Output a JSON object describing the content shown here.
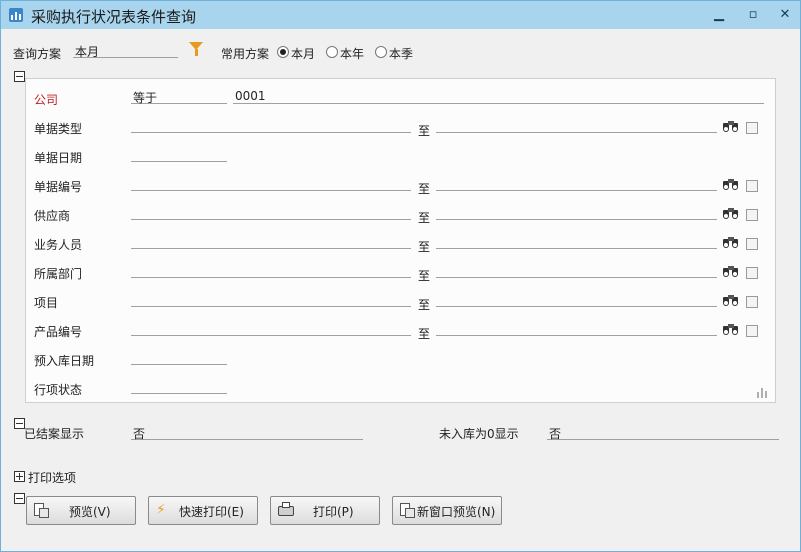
{
  "window": {
    "title": "采购执行状况表条件查询"
  },
  "scheme": {
    "label": "查询方案",
    "value": "本月",
    "common_label": "常用方案",
    "options": [
      {
        "label": "本月",
        "selected": true
      },
      {
        "label": "本年",
        "selected": false
      },
      {
        "label": "本季",
        "selected": false
      }
    ]
  },
  "conditions": {
    "company": {
      "label": "公司",
      "operator": "等于",
      "value": "0001"
    },
    "range_separator": "至",
    "rows": [
      {
        "label": "单据类型",
        "type": "range"
      },
      {
        "label": "单据日期",
        "type": "single"
      },
      {
        "label": "单据编号",
        "type": "range"
      },
      {
        "label": "供应商",
        "type": "range"
      },
      {
        "label": "业务人员",
        "type": "range"
      },
      {
        "label": "所属部门",
        "type": "range"
      },
      {
        "label": "项目",
        "type": "range"
      },
      {
        "label": "产品编号",
        "type": "range"
      },
      {
        "label": "预入库日期",
        "type": "single"
      },
      {
        "label": "行项状态",
        "type": "single"
      }
    ]
  },
  "extra": {
    "closed_label": "已结案显示",
    "closed_value": "否",
    "unreceived_label": "未入库为0显示",
    "unreceived_value": "否"
  },
  "print_options": {
    "label": "打印选项"
  },
  "buttons": {
    "preview": "预览(V)",
    "quick_print": "快速打印(E)",
    "print": "打印(P)",
    "new_window_preview": "新窗口预览(N)"
  },
  "colors": {
    "title_bar": "#a8d4ee",
    "company_label": "#c02020"
  }
}
